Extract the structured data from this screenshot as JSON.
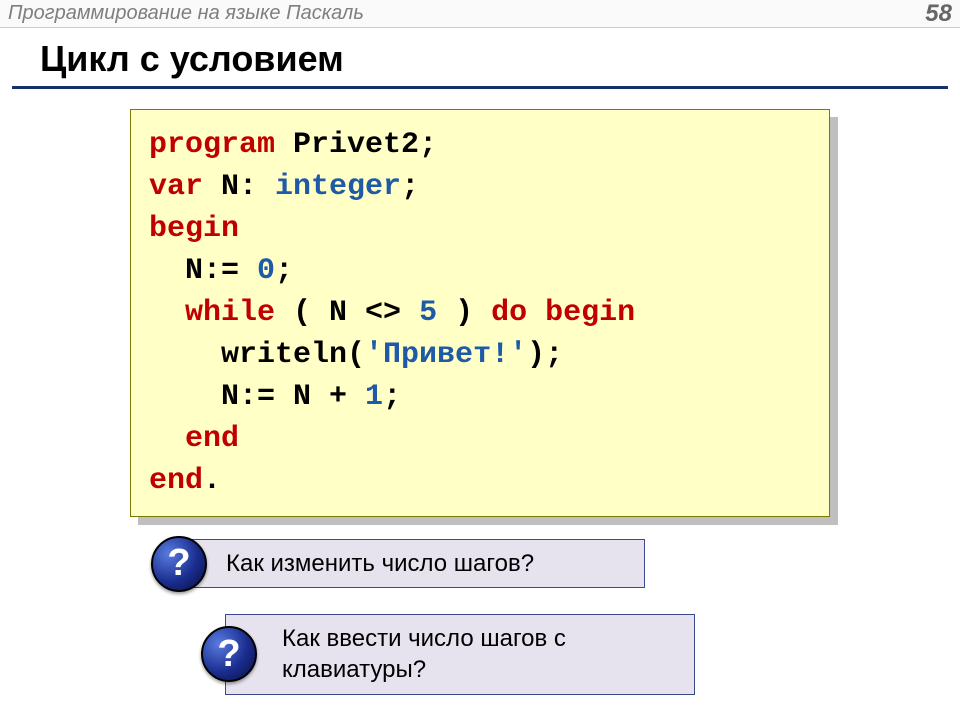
{
  "header": {
    "title": "Программирование на языке Паскаль",
    "page": "58"
  },
  "slide_title": "Цикл с условием",
  "code": {
    "l1_kw": "program",
    "l1_rest": " Privet2;",
    "l2_kw1": "var",
    "l2_mid": " N: ",
    "l2_type": "integer",
    "l2_end": ";",
    "l3_kw": "begin",
    "l4_a": "  N:= ",
    "l4_num": "0",
    "l4_b": ";",
    "l5_kw1": "  while",
    "l5_a": " ( N <> ",
    "l5_num": "5",
    "l5_b": " ) ",
    "l5_kw2": "do begin",
    "l6_a": "    writeln(",
    "l6_str": "'Привет!'",
    "l6_b": ");",
    "l7_a": "    N:= N + ",
    "l7_num": "1",
    "l7_b": ";",
    "l8_kw": "  end",
    "l9_kw": "end",
    "l9_b": "."
  },
  "questions": {
    "badge": "?",
    "q1": "Как изменить число шагов?",
    "q2": "Как ввести число шагов с клавиатуры?"
  }
}
